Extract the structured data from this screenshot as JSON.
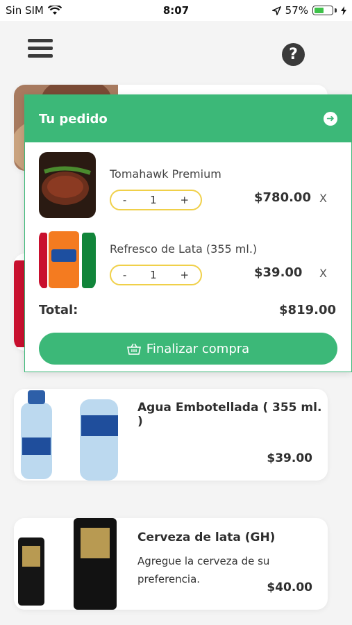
{
  "status_bar": {
    "carrier": "Sin SIM",
    "time": "8:07",
    "battery": "57%",
    "battery_level": 0.57
  },
  "order": {
    "title": "Tu pedido",
    "items": [
      {
        "name": "Tomahawk Premium",
        "qty_minus": "-",
        "qty": "1",
        "qty_plus": "+",
        "price": "$780.00",
        "remove": "X"
      },
      {
        "name": "Refresco de Lata (355 ml.)",
        "qty_minus": "-",
        "qty": "1",
        "qty_plus": "+",
        "price": "$39.00",
        "remove": "X"
      }
    ],
    "total_label": "Total:",
    "total_value": "$819.00",
    "checkout_label": "Finalizar compra"
  },
  "products": [
    {
      "title": "Agua Embotellada ( 355 ml. )",
      "description": "",
      "price": "$39.00"
    },
    {
      "title": "Cerveza de lata (GH)",
      "description": "Agregue la cerveza de su preferencia.",
      "price": "$40.00"
    }
  ],
  "colors": {
    "accent": "#3cb878",
    "stepper_border": "#f0d049"
  }
}
